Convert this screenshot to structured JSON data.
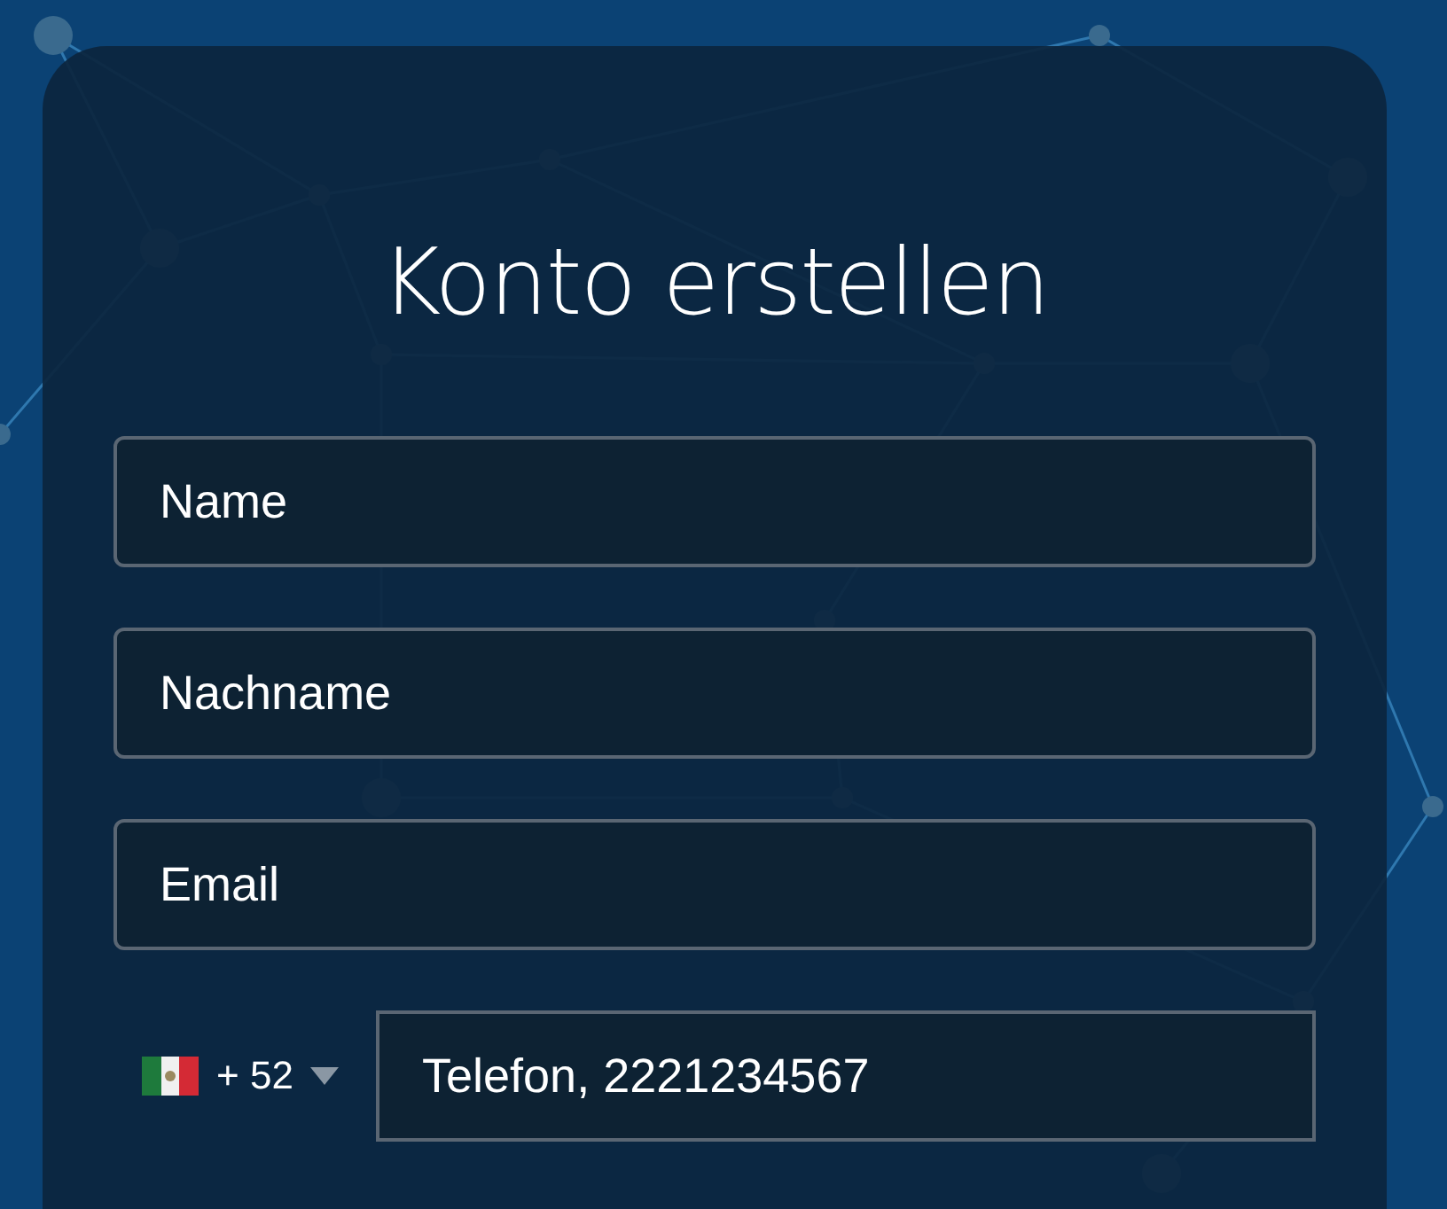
{
  "title": "Konto erstellen",
  "fields": [
    {
      "placeholder": "Name"
    },
    {
      "placeholder": "Nachname"
    },
    {
      "placeholder": "Email"
    }
  ],
  "phone": {
    "country_code": "+ 52",
    "placeholder": "Telefon, 2221234567"
  }
}
